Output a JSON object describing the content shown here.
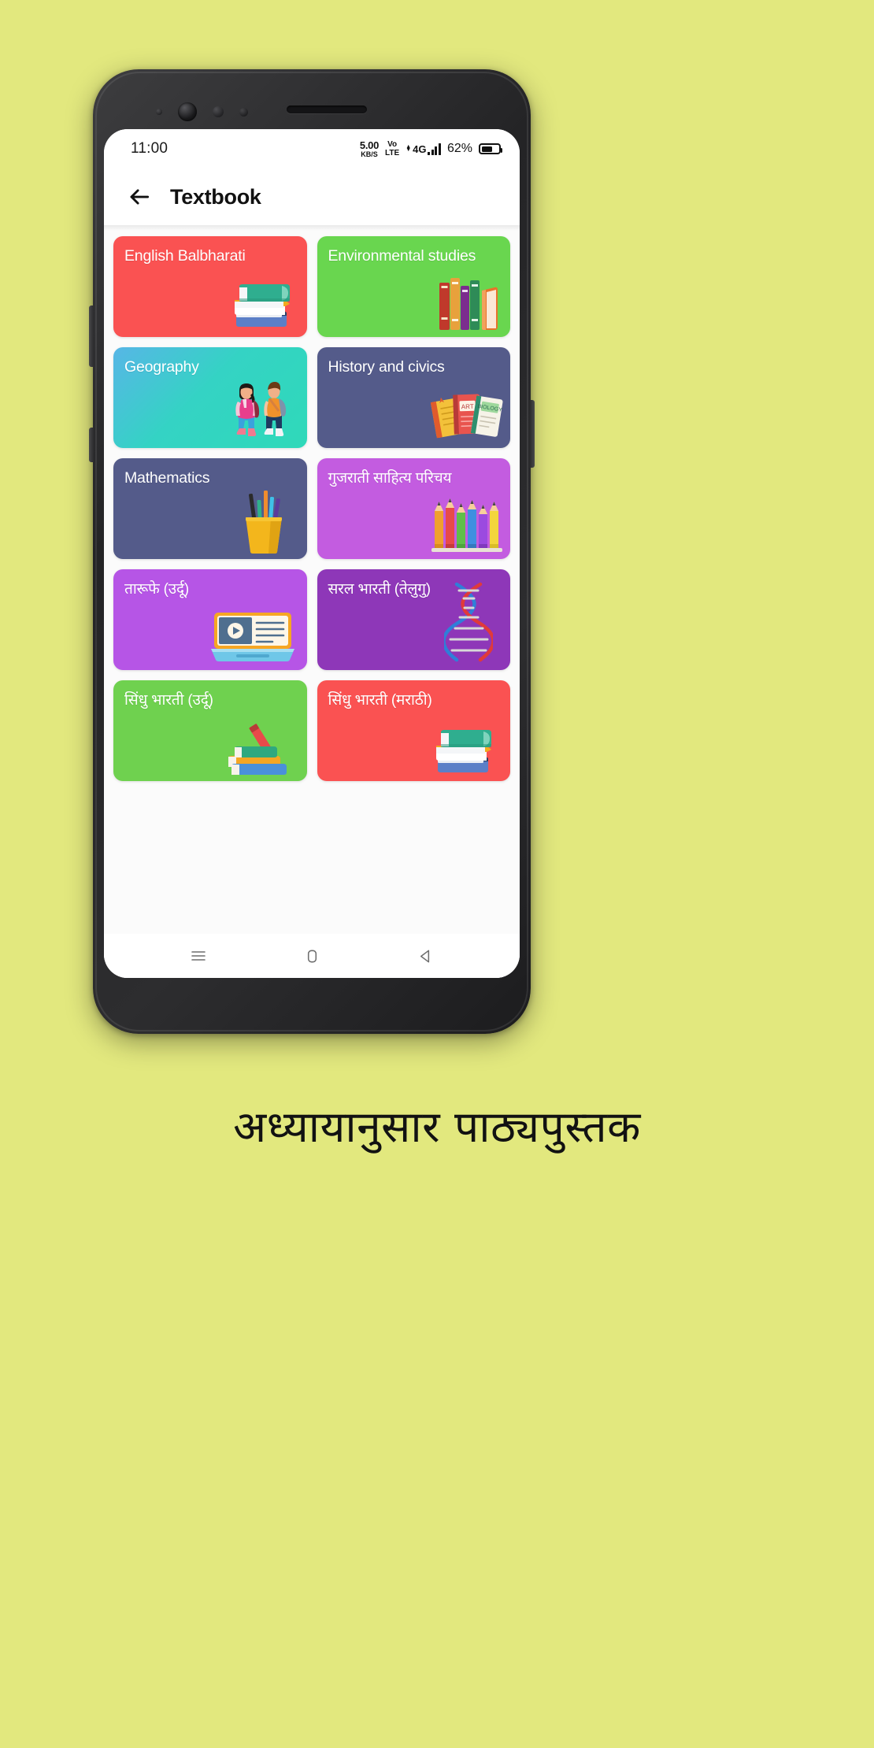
{
  "background_color": "#e2e87e",
  "status_bar": {
    "clock": "11:00",
    "net_speed_value": "5.00",
    "net_speed_unit": "KB/S",
    "volte_line1": "Vo",
    "volte_line2": "LTE",
    "network_type": "4G",
    "battery_percent": "62%"
  },
  "app_bar": {
    "back_icon": "arrow-left-icon",
    "title": "Textbook"
  },
  "cards": [
    {
      "title": "English Balbharati",
      "color": "#fa5252",
      "art": "book-stack-icon",
      "text_color": "#ffffff"
    },
    {
      "title": "Environmental studies",
      "color": "#69d košice",
      "art": "upright-books-icon",
      "text_color": "#ffffff"
    },
    {
      "title": "Geography",
      "color": "gradient-blue-teal",
      "art": "students-walking-icon",
      "text_color": "#ffffff"
    },
    {
      "title": "History and civics",
      "color": "#545b8a",
      "art": "notebooks-icon",
      "text_color": "#ffffff"
    },
    {
      "title": "Mathematics",
      "color": "#545b8a",
      "art": "pencil-cup-icon",
      "text_color": "#ffffff"
    },
    {
      "title": "गुजराती साहित्य परिचय",
      "color": "#c35ce0",
      "art": "colored-pencils-icon",
      "text_color": "#ffffff"
    },
    {
      "title": "तारूफे (उर्दू)",
      "color": "#b655e6",
      "art": "open-book-video-icon",
      "text_color": "#ffffff"
    },
    {
      "title": "सरल भारती (तेलुगु)",
      "color": "#8e37b8",
      "art": "dna-helix-icon",
      "text_color": "#ffffff"
    },
    {
      "title": "सिंधु भारती (उर्दू)",
      "color": "#6fd14f",
      "art": "books-pencil-icon",
      "text_color": "#ffffff"
    },
    {
      "title": "सिंधु भारती (मराठी)",
      "color": "#fa5252",
      "art": "book-stack-icon",
      "text_color": "#ffffff"
    }
  ],
  "nav_bar": {
    "menu_icon": "menu-icon",
    "home_icon": "home-square-icon",
    "back_icon": "back-triangle-icon"
  },
  "caption": "अध्यायानुसार पाठ्यपुस्तक"
}
